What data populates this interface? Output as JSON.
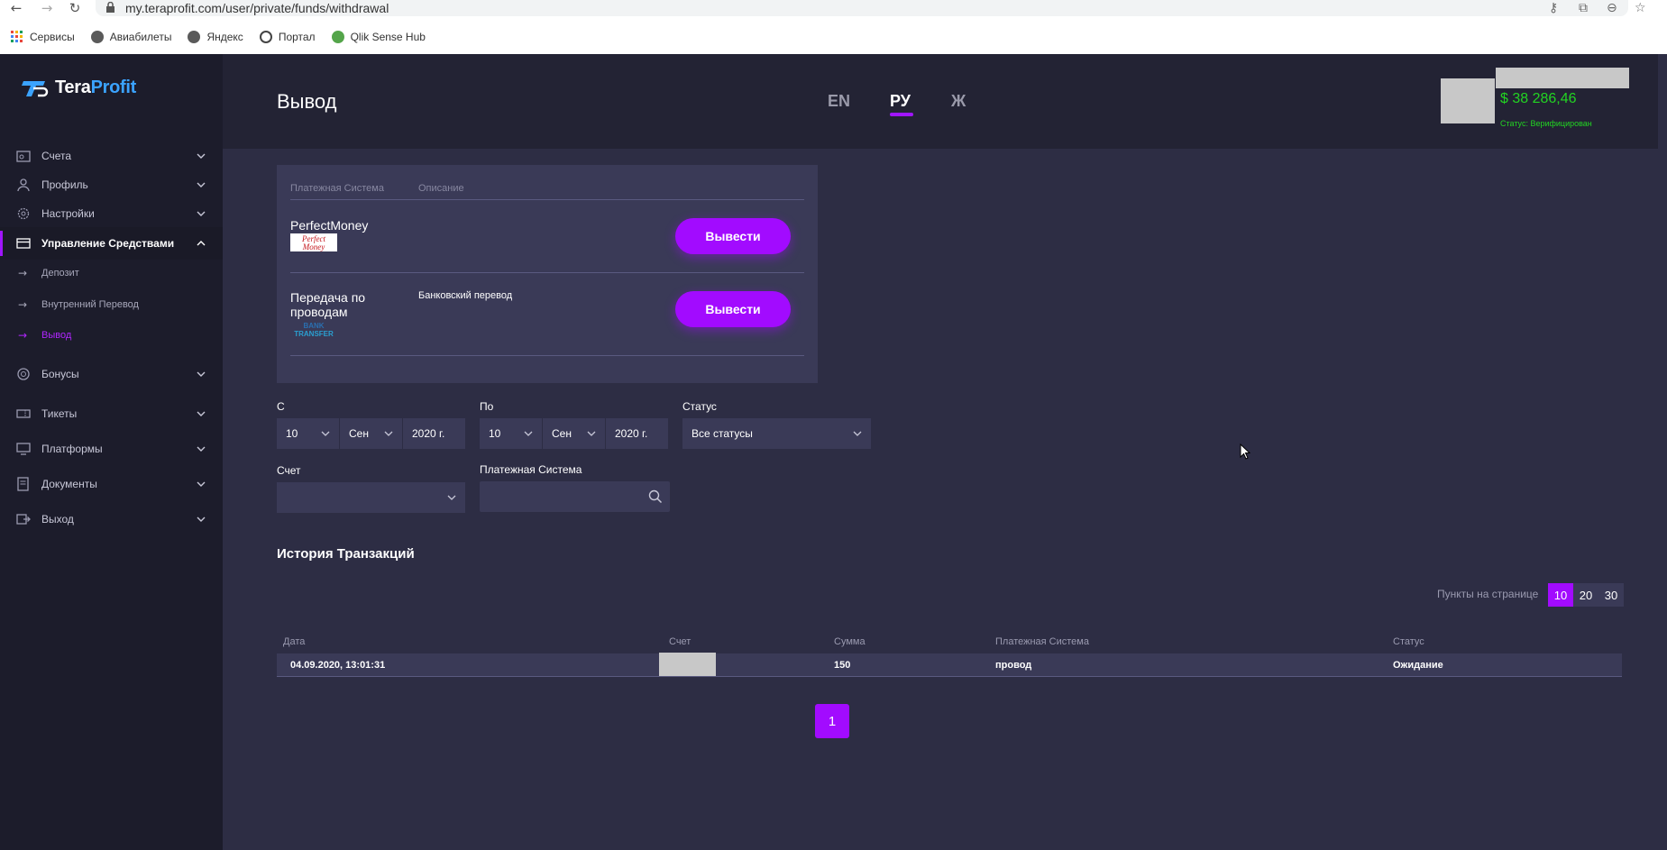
{
  "browser": {
    "url": "my.teraprofit.com/user/private/funds/withdrawal",
    "bookmarks": [
      "Сервисы",
      "Авиабилеты",
      "Яндекс",
      "Портал",
      "Qlik Sense Hub"
    ]
  },
  "sidebar": {
    "logo_a": "Tera",
    "logo_b": "Profit",
    "items": [
      {
        "label": "Счета",
        "icon": "accounts-icon"
      },
      {
        "label": "Профиль",
        "icon": "profile-icon"
      },
      {
        "label": "Настройки",
        "icon": "settings-icon"
      },
      {
        "label": "Управление Средствами",
        "icon": "wallet-icon"
      },
      {
        "label": "Бонусы",
        "icon": "bonus-icon"
      },
      {
        "label": "Тикеты",
        "icon": "tickets-icon"
      },
      {
        "label": "Платформы",
        "icon": "platforms-icon"
      },
      {
        "label": "Документы",
        "icon": "documents-icon"
      },
      {
        "label": "Выход",
        "icon": "logout-icon"
      }
    ],
    "sub_items": [
      "Депозит",
      "Внутренний Перевод",
      "Вывод"
    ]
  },
  "header": {
    "title": "Вывод",
    "languages": [
      "EN",
      "РУ",
      "Ж"
    ],
    "active_language": "РУ",
    "balance": "$ 38 286,46",
    "status": "Статус: Верифицирован"
  },
  "payment_systems": {
    "col_system": "Платежная Система",
    "col_description": "Описание",
    "rows": [
      {
        "name": "PerfectMoney",
        "description": "",
        "logo_text": "Perfect Money",
        "button": "Вывести"
      },
      {
        "name": "Передача по проводам",
        "description": "Банковский перевод",
        "logo_text": "BANK TRANSFER",
        "button": "Вывести"
      }
    ]
  },
  "filters": {
    "from_label": "С",
    "to_label": "По",
    "status_label": "Статус",
    "account_label": "Счет",
    "system_label": "Платежная Система",
    "from_day": "10",
    "from_month": "Сен",
    "from_year": "2020 г.",
    "to_day": "10",
    "to_month": "Сен",
    "to_year": "2020 г.",
    "status_value": "Все статусы",
    "account_value": "",
    "system_value": ""
  },
  "history": {
    "title": "История Транзакций",
    "per_page_label": "Пункты на странице",
    "per_page_options": [
      "10",
      "20",
      "30"
    ],
    "per_page_selected": "10",
    "columns": [
      "Дата",
      "Счет",
      "Сумма",
      "Платежная Система",
      "Статус"
    ],
    "rows": [
      {
        "date": "04.09.2020, 13:01:31",
        "account": "",
        "amount": "150",
        "system": "провод",
        "status": "Ожидание"
      }
    ],
    "current_page": "1"
  },
  "colors": {
    "accent": "#a20bff",
    "balance": "#22d422",
    "sidebar_bg": "#1c1c2b",
    "content_bg": "#2d2d44",
    "panel_bg": "#3a3a57"
  }
}
